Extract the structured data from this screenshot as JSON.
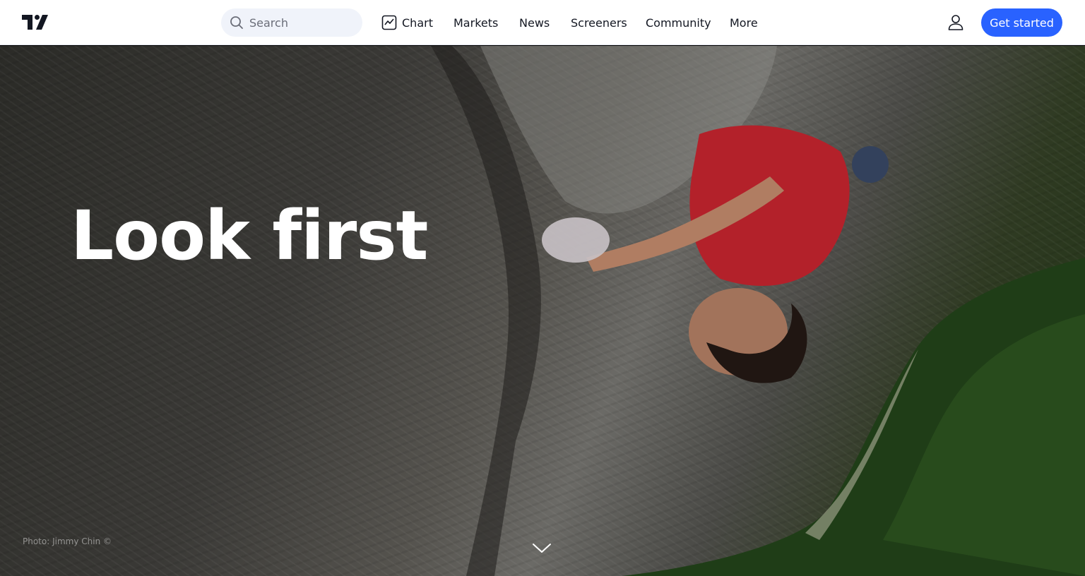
{
  "header": {
    "logo": "tradingview-logo",
    "search": {
      "placeholder": "Search",
      "value": "",
      "icon": "search-icon"
    },
    "nav": [
      {
        "label": "Chart",
        "icon": "chart-icon"
      },
      {
        "label": "Markets"
      },
      {
        "label": "News"
      },
      {
        "label": "Screeners"
      },
      {
        "label": "Community"
      },
      {
        "label": "More"
      }
    ],
    "user_icon": "user-icon",
    "cta_label": "Get started",
    "cta_color": "#2962ff"
  },
  "hero": {
    "headline": "Look first",
    "photo_credit": "Photo: Jimmy Chin ©",
    "scroll_icon": "chevron-down-icon"
  }
}
